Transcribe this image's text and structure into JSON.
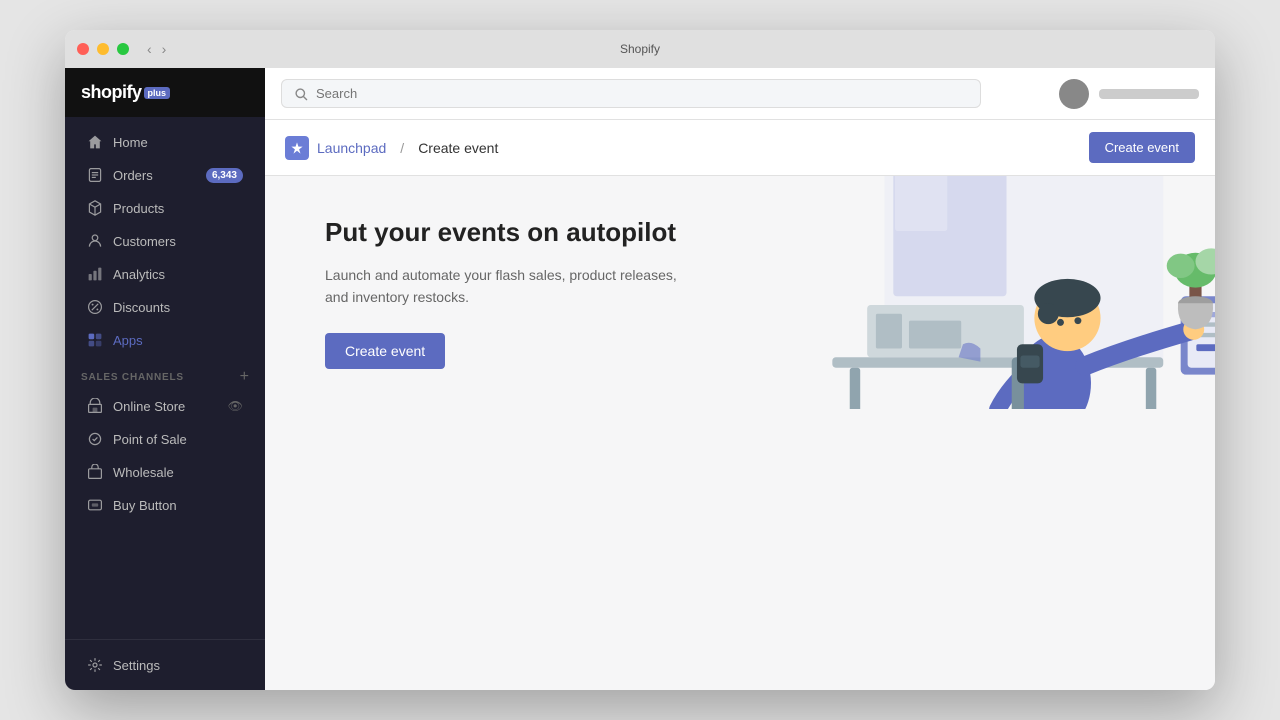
{
  "window": {
    "title": "Shopify",
    "traffic_lights": [
      "red",
      "yellow",
      "green"
    ]
  },
  "sidebar": {
    "logo": "shopify",
    "logo_suffix": "plus",
    "nav_items": [
      {
        "id": "home",
        "label": "Home",
        "icon": "home-icon",
        "badge": null,
        "active": false
      },
      {
        "id": "orders",
        "label": "Orders",
        "icon": "orders-icon",
        "badge": "6,343",
        "active": false
      },
      {
        "id": "products",
        "label": "Products",
        "icon": "products-icon",
        "badge": null,
        "active": false
      },
      {
        "id": "customers",
        "label": "Customers",
        "icon": "customers-icon",
        "badge": null,
        "active": false
      },
      {
        "id": "analytics",
        "label": "Analytics",
        "icon": "analytics-icon",
        "badge": null,
        "active": false
      },
      {
        "id": "discounts",
        "label": "Discounts",
        "icon": "discounts-icon",
        "badge": null,
        "active": false
      },
      {
        "id": "apps",
        "label": "Apps",
        "icon": "apps-icon",
        "badge": null,
        "active": false,
        "highlight": true
      }
    ],
    "sales_channels_label": "SALES CHANNELS",
    "sales_channel_items": [
      {
        "id": "online-store",
        "label": "Online Store",
        "icon": "store-icon"
      },
      {
        "id": "point-of-sale",
        "label": "Point of Sale",
        "icon": "pos-icon"
      },
      {
        "id": "wholesale",
        "label": "Wholesale",
        "icon": "wholesale-icon"
      },
      {
        "id": "buy-button",
        "label": "Buy Button",
        "icon": "buy-button-icon"
      }
    ],
    "settings_label": "Settings",
    "settings_icon": "settings-icon"
  },
  "topbar": {
    "search_placeholder": "Search"
  },
  "breadcrumb": {
    "parent": "Launchpad",
    "current": "Create event"
  },
  "header_button": "Create event",
  "hero": {
    "title": "Put your events on autopilot",
    "subtitle": "Launch and automate your flash sales, product releases, and inventory restocks.",
    "cta_button": "Create event"
  }
}
